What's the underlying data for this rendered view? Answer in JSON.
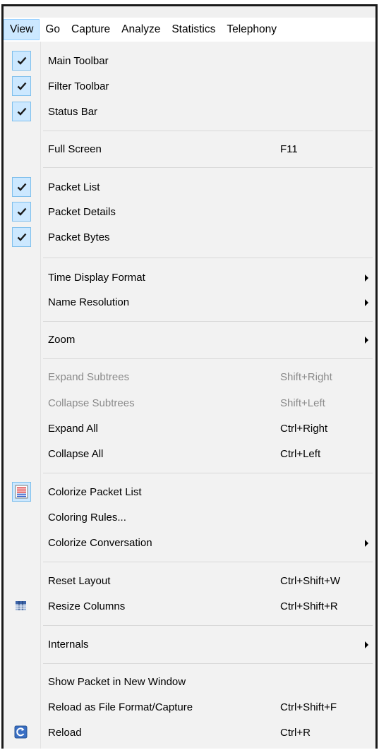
{
  "menubar": {
    "items": [
      {
        "label": "View",
        "active": true
      },
      {
        "label": "Go"
      },
      {
        "label": "Capture"
      },
      {
        "label": "Analyze"
      },
      {
        "label": "Statistics"
      },
      {
        "label": "Telephony"
      }
    ]
  },
  "menu": {
    "main_toolbar": {
      "label": "Main Toolbar",
      "checked": true
    },
    "filter_toolbar": {
      "label": "Filter Toolbar",
      "checked": true
    },
    "status_bar": {
      "label": "Status Bar",
      "checked": true
    },
    "full_screen": {
      "label": "Full Screen",
      "shortcut": "F11"
    },
    "packet_list": {
      "label": "Packet List",
      "checked": true
    },
    "packet_details": {
      "label": "Packet Details",
      "checked": true
    },
    "packet_bytes": {
      "label": "Packet Bytes",
      "checked": true
    },
    "time_display_format": {
      "label": "Time Display Format",
      "submenu": true
    },
    "name_resolution": {
      "label": "Name Resolution",
      "submenu": true
    },
    "zoom": {
      "label": "Zoom",
      "submenu": true
    },
    "expand_subtrees": {
      "label": "Expand Subtrees",
      "shortcut": "Shift+Right",
      "disabled": true
    },
    "collapse_subtrees": {
      "label": "Collapse Subtrees",
      "shortcut": "Shift+Left",
      "disabled": true
    },
    "expand_all": {
      "label": "Expand All",
      "shortcut": "Ctrl+Right"
    },
    "collapse_all": {
      "label": "Collapse All",
      "shortcut": "Ctrl+Left"
    },
    "colorize_packet_list": {
      "label": "Colorize Packet List",
      "checked": true,
      "icon": "colorize-list-icon"
    },
    "coloring_rules": {
      "label": "Coloring Rules..."
    },
    "colorize_conversation": {
      "label": "Colorize Conversation",
      "submenu": true
    },
    "reset_layout": {
      "label": "Reset Layout",
      "shortcut": "Ctrl+Shift+W"
    },
    "resize_columns": {
      "label": "Resize Columns",
      "shortcut": "Ctrl+Shift+R",
      "icon": "resize-columns-icon"
    },
    "internals": {
      "label": "Internals",
      "submenu": true
    },
    "show_packet_new_window": {
      "label": "Show Packet in New Window"
    },
    "reload_as_file_format": {
      "label": "Reload as File Format/Capture",
      "shortcut": "Ctrl+Shift+F"
    },
    "reload": {
      "label": "Reload",
      "shortcut": "Ctrl+R",
      "icon": "reload-icon"
    }
  },
  "colors": {
    "check_highlight": "#cce8ff",
    "check_border": "#7fbfec",
    "disabled_text": "#8a8a8a",
    "menu_background": "#f2f2f2"
  }
}
